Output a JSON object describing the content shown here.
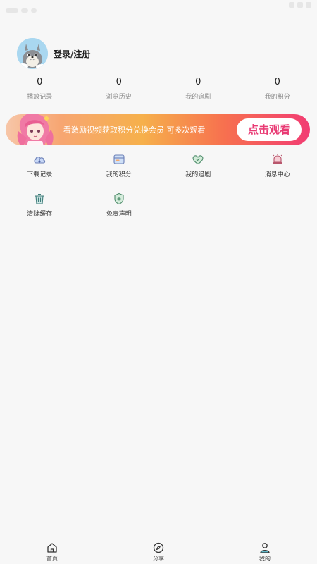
{
  "profile": {
    "login_label": "登录/注册"
  },
  "stats": [
    {
      "value": "0",
      "label": "播放记录"
    },
    {
      "value": "0",
      "label": "浏览历史"
    },
    {
      "value": "0",
      "label": "我的追剧"
    },
    {
      "value": "0",
      "label": "我的积分"
    }
  ],
  "banner": {
    "text": "看激励视频获取积分兑换会员  可多次观看",
    "button_label": "点击观看",
    "colors": {
      "start": "#f7a672",
      "end": "#f23c73",
      "button_text": "#e93a74"
    }
  },
  "menu": [
    {
      "label": "下载记录",
      "icon": "cloud-download-icon"
    },
    {
      "label": "我的积分",
      "icon": "points-card-icon"
    },
    {
      "label": "我的追剧",
      "icon": "heart-icon"
    },
    {
      "label": "消息中心",
      "icon": "bell-icon"
    },
    {
      "label": "清除缓存",
      "icon": "trash-icon"
    },
    {
      "label": "免责声明",
      "icon": "shield-icon"
    }
  ],
  "tabbar": [
    {
      "label": "首页",
      "icon": "home-icon"
    },
    {
      "label": "分享",
      "icon": "compass-icon"
    },
    {
      "label": "我的",
      "icon": "user-icon",
      "active": true
    }
  ]
}
